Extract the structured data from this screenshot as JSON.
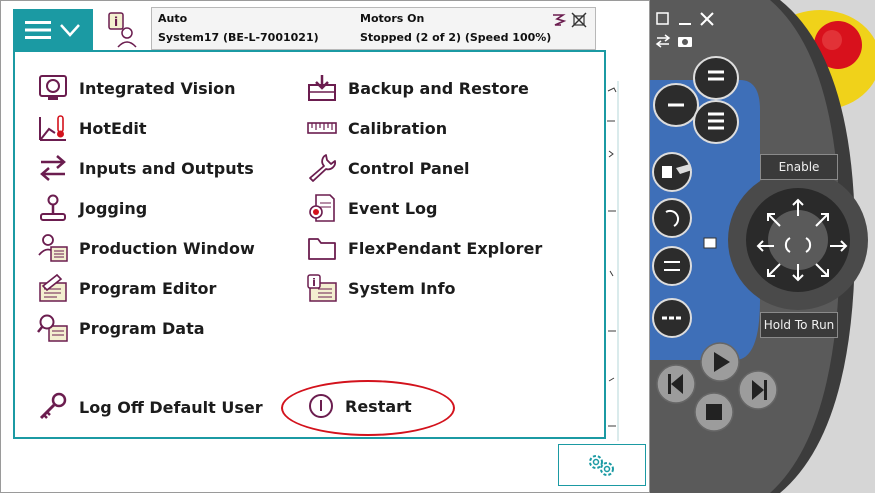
{
  "status": {
    "mode": "Auto",
    "system": "System17 (BE-L-7001021)",
    "motors": "Motors On",
    "state": "Stopped (2 of 2) (Speed 100%)"
  },
  "menu": {
    "left_items": [
      {
        "label": "Integrated Vision"
      },
      {
        "label": "HotEdit"
      },
      {
        "label": "Inputs and Outputs"
      },
      {
        "label": "Jogging"
      },
      {
        "label": "Production Window"
      },
      {
        "label": "Program Editor"
      },
      {
        "label": "Program Data"
      }
    ],
    "right_items": [
      {
        "label": "Backup and Restore"
      },
      {
        "label": "Calibration"
      },
      {
        "label": "Control Panel"
      },
      {
        "label": "Event Log"
      },
      {
        "label": "FlexPendant Explorer"
      },
      {
        "label": "System Info"
      }
    ],
    "log_off": "Log Off Default User",
    "restart": "Restart"
  },
  "pendant": {
    "enable": "Enable",
    "hold_to_run": "Hold To Run"
  },
  "colors": {
    "accent": "#1b9aa3",
    "icon": "#6b1d4f",
    "highlight": "#d3121c",
    "pendant_blue": "#3e6fb8",
    "stop_yellow": "#f0d21a",
    "stop_red": "#d8111c"
  }
}
